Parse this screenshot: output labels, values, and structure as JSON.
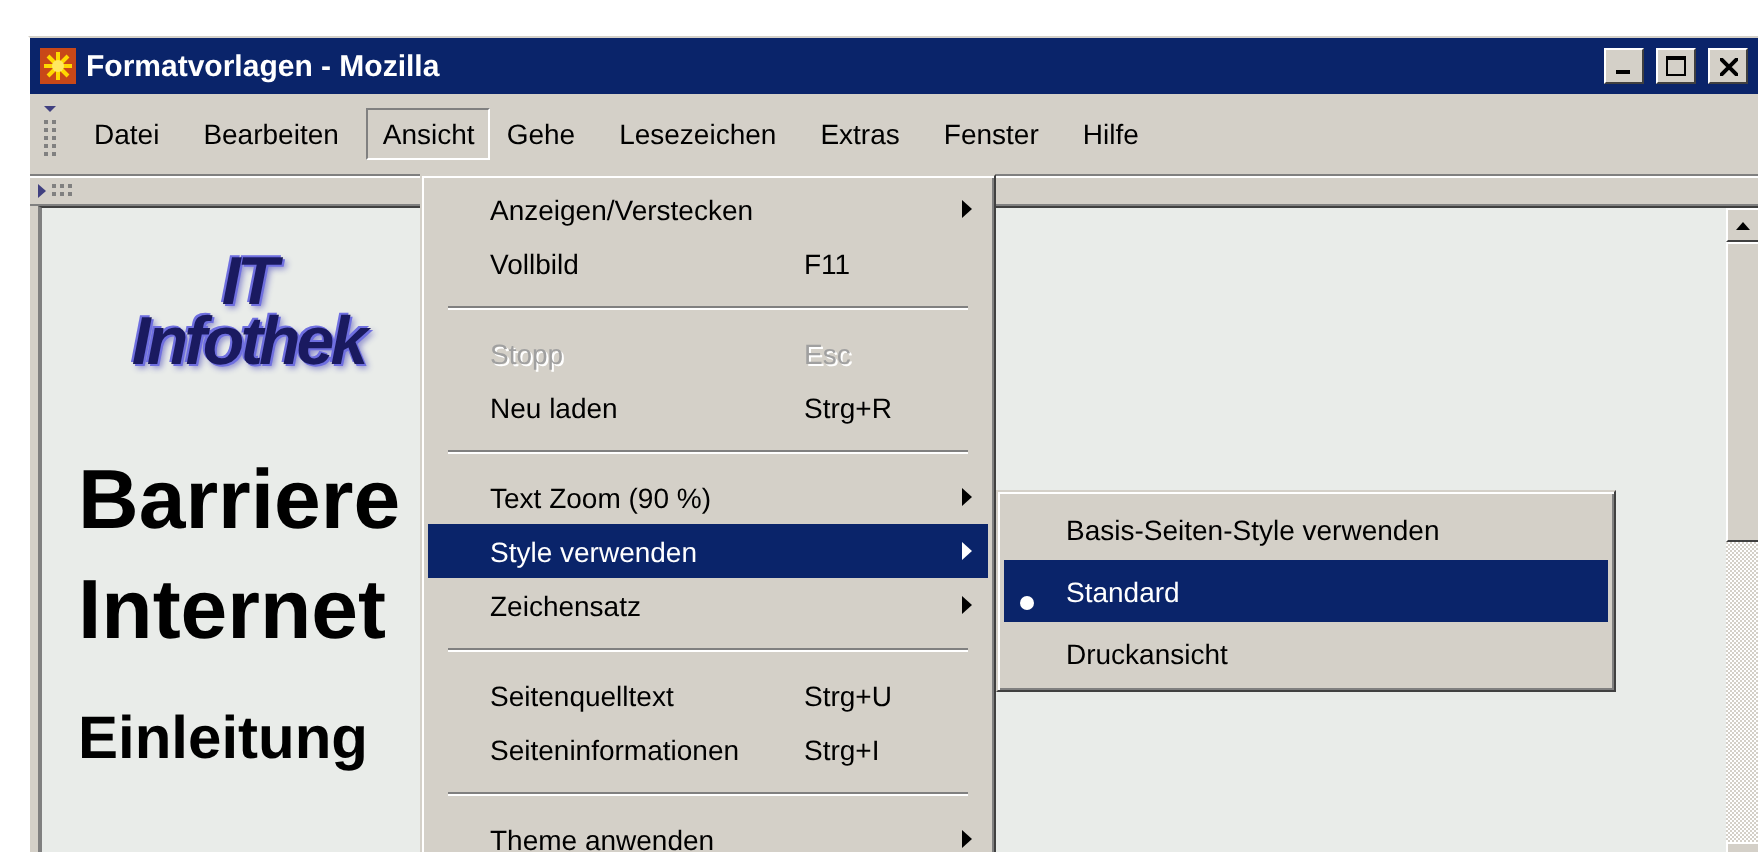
{
  "window": {
    "title": "Formatvorlagen - Mozilla"
  },
  "menubar": [
    {
      "label": "Datei",
      "selected": false
    },
    {
      "label": "Bearbeiten",
      "selected": false
    },
    {
      "label": "Ansicht",
      "selected": true
    },
    {
      "label": "Gehe",
      "selected": false
    },
    {
      "label": "Lesezeichen",
      "selected": false
    },
    {
      "label": "Extras",
      "selected": false
    },
    {
      "label": "Fenster",
      "selected": false
    },
    {
      "label": "Hilfe",
      "selected": false
    }
  ],
  "content": {
    "logo_lines": [
      "IT",
      "Infothek"
    ],
    "headings": [
      {
        "text": "Barriere",
        "kind": "title"
      },
      {
        "text": "Internet",
        "kind": "title"
      },
      {
        "text": "Einleitung",
        "kind": "section"
      }
    ]
  },
  "menu": [
    {
      "kind": "item",
      "label": "Anzeigen/Verstecken",
      "submenu": true,
      "disabled": false,
      "selected": false
    },
    {
      "kind": "item",
      "label": "Vollbild",
      "shortcut": "F11",
      "submenu": false,
      "disabled": false,
      "selected": false
    },
    {
      "kind": "separator"
    },
    {
      "kind": "item",
      "label": "Stopp",
      "shortcut": "Esc",
      "submenu": false,
      "disabled": true,
      "selected": false
    },
    {
      "kind": "item",
      "label": "Neu laden",
      "shortcut": "Strg+R",
      "submenu": false,
      "disabled": false,
      "selected": false
    },
    {
      "kind": "separator"
    },
    {
      "kind": "item",
      "label": "Text Zoom (90 %)",
      "submenu": true,
      "disabled": false,
      "selected": false
    },
    {
      "kind": "item",
      "label": "Style verwenden",
      "submenu": true,
      "disabled": false,
      "selected": true
    },
    {
      "kind": "item",
      "label": "Zeichensatz",
      "submenu": true,
      "disabled": false,
      "selected": false
    },
    {
      "kind": "separator"
    },
    {
      "kind": "item",
      "label": "Seitenquelltext",
      "shortcut": "Strg+U",
      "submenu": false,
      "disabled": false,
      "selected": false
    },
    {
      "kind": "item",
      "label": "Seiteninformationen",
      "shortcut": "Strg+I",
      "submenu": false,
      "disabled": false,
      "selected": false
    },
    {
      "kind": "separator"
    },
    {
      "kind": "item",
      "label": "Theme anwenden",
      "submenu": true,
      "disabled": false,
      "selected": false
    }
  ],
  "submenu": [
    {
      "label": "Basis-Seiten-Style verwenden",
      "checked": false,
      "selected": false
    },
    {
      "label": "Standard",
      "checked": true,
      "selected": true
    },
    {
      "label": "Druckansicht",
      "checked": false,
      "selected": false
    }
  ]
}
